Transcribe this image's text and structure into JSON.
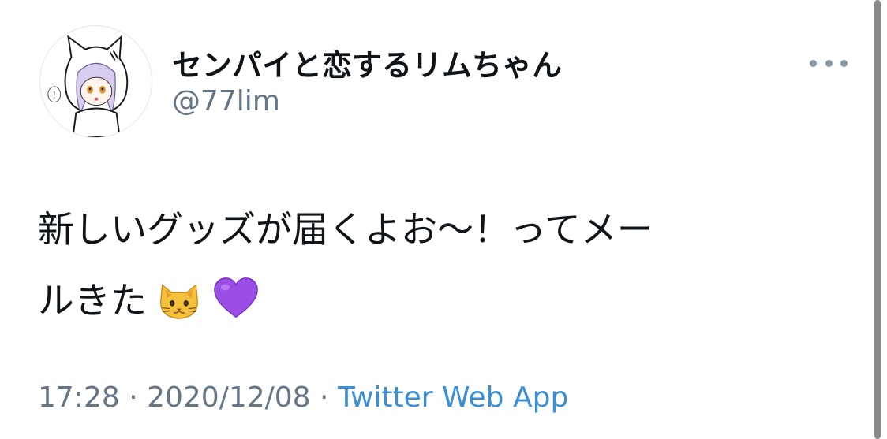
{
  "user": {
    "display_name": "センパイと恋するリムちゃん",
    "handle": "@77lim",
    "avatar_icon": "anime-girl-cat-hood-avatar"
  },
  "tweet": {
    "text_line1": "新しいグッズが届くよお〜！ってメー",
    "text_line2": "ルきた",
    "emojis": [
      "cat-face-emoji",
      "purple-heart-emoji"
    ]
  },
  "meta": {
    "time": "17:28",
    "separator1": " · ",
    "date": "2020/12/08",
    "separator2": " · ",
    "source": "Twitter Web App"
  },
  "colors": {
    "text": "#0f1419",
    "secondary": "#657786",
    "link": "#3b8fd6",
    "purple_heart": "#9b4ee6",
    "cat": "#f4c23c"
  },
  "icons": {
    "more": "more-horizontal-icon"
  }
}
